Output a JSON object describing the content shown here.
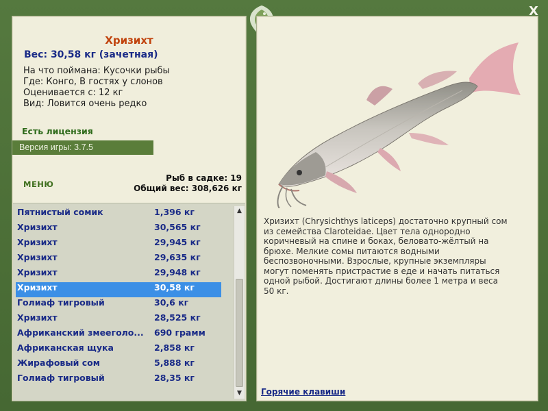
{
  "window": {
    "close_label": "X"
  },
  "fish": {
    "title": "Хризихт",
    "weight": "Вес: 30,58 кг (зачетная)",
    "caught_on": "На что поймана: Кусочки рыбы",
    "location": "Где: Конго, В гостях у слонов",
    "rated_from": "Оценивается с: 12 кг",
    "rarity": "Вид: Ловится очень редко"
  },
  "license": "Есть лицензия",
  "version": "Версия игры: 3.7.5",
  "menu_label": "МЕНЮ",
  "cage": {
    "count": "Рыб в садке: 19",
    "total_weight": "Общий вес: 308,626 кг"
  },
  "catch_list": [
    {
      "name": "Пятнистый сомик",
      "weight": "1,396 кг",
      "selected": false
    },
    {
      "name": "Хризихт",
      "weight": "30,565 кг",
      "selected": false
    },
    {
      "name": "Хризихт",
      "weight": "29,945 кг",
      "selected": false
    },
    {
      "name": "Хризихт",
      "weight": "29,635 кг",
      "selected": false
    },
    {
      "name": "Хризихт",
      "weight": "29,948 кг",
      "selected": false
    },
    {
      "name": "Хризихт",
      "weight": "30,58 кг",
      "selected": true
    },
    {
      "name": "Голиаф тигровый",
      "weight": "30,6 кг",
      "selected": false
    },
    {
      "name": "Хризихт",
      "weight": "28,525 кг",
      "selected": false
    },
    {
      "name": "Африканский змееголо...",
      "weight": "690 грамм",
      "selected": false
    },
    {
      "name": "Африканская щука",
      "weight": "2,858 кг",
      "selected": false
    },
    {
      "name": "Жирафовый сом",
      "weight": "5,888 кг",
      "selected": false
    },
    {
      "name": "Голиаф тигровый",
      "weight": "28,35 кг",
      "selected": false
    }
  ],
  "description": "Хризихт (Chrysichthys laticeps) достаточно крупный сом из семейства Claroteidae. Цвет тела однородно коричневый на спине и боках, беловато-жёлтый на брюхе. Мелкие сомы питаются водными беспозвоночными. Взрослые, крупные экземпляры могут поменять пристрастие в еде и начать питаться одной рыбой. Достигают длины более 1 метра и веса 50 кг.",
  "hotkeys_label": "Горячие клавиши",
  "icons": {
    "close": "close-icon",
    "emblem": "fish-emblem-icon",
    "scroll_up": "arrow-up-icon",
    "scroll_down": "arrow-down-icon"
  },
  "colors": {
    "frame": "#4d7038",
    "title": "#c1440e",
    "weight": "#1a2b87",
    "selection": "#3b8fe6",
    "license": "#2d6a1a"
  }
}
